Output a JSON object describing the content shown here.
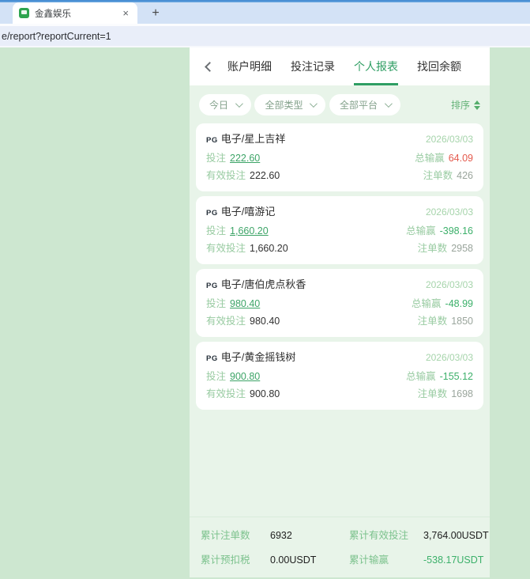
{
  "browser": {
    "tab_title": "金鑫娱乐",
    "close_icon": "×",
    "new_tab_icon": "+",
    "url": "e/report?reportCurrent=1"
  },
  "header": {
    "tabs": [
      {
        "label": "账户明细",
        "active": false
      },
      {
        "label": "投注记录",
        "active": false
      },
      {
        "label": "个人报表",
        "active": true
      },
      {
        "label": "找回余额",
        "active": false
      }
    ]
  },
  "filters": {
    "pills": [
      {
        "label": "今日"
      },
      {
        "label": "全部类型"
      },
      {
        "label": "全部平台"
      }
    ],
    "sort_label": "排序"
  },
  "card_labels": {
    "bet": "投注",
    "winloss": "总输赢",
    "valid": "有效投注",
    "count": "注单数"
  },
  "cards": [
    {
      "provider": "PG",
      "name": "电子/星上吉祥",
      "date": "2026/03/03",
      "bet": "222.60",
      "winloss": "64.09",
      "valid": "222.60",
      "count": "426"
    },
    {
      "provider": "PG",
      "name": "电子/嘻游记",
      "date": "2026/03/03",
      "bet": "1,660.20",
      "winloss": "-398.16",
      "valid": "1,660.20",
      "count": "2958"
    },
    {
      "provider": "PG",
      "name": "电子/唐伯虎点秋香",
      "date": "2026/03/03",
      "bet": "980.40",
      "winloss": "-48.99",
      "valid": "980.40",
      "count": "1850"
    },
    {
      "provider": "PG",
      "name": "电子/黄金摇钱树",
      "date": "2026/03/03",
      "bet": "900.80",
      "winloss": "-155.12",
      "valid": "900.80",
      "count": "1698"
    }
  ],
  "summary": [
    {
      "label": "累计注单数",
      "value": "6932",
      "negative": false
    },
    {
      "label": "累计有效投注",
      "value": "3,764.00USDT",
      "negative": false
    },
    {
      "label": "累计预扣税",
      "value": "0.00USDT",
      "negative": false
    },
    {
      "label": "累计输赢",
      "value": "-538.17USDT",
      "negative": true
    }
  ],
  "colors": {
    "accent_green": "#2f9e63",
    "background_green": "#cde7d0",
    "panel_green": "#e8f4e9",
    "label_green": "#98cba1",
    "link_green": "#3da467",
    "negative_green": "#3cb06a",
    "positive_red": "#e45a4d"
  }
}
